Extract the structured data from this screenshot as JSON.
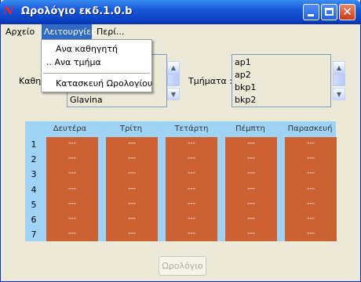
{
  "window": {
    "title": "Ωρολόγιο εκδ.1.0.b",
    "icon_glyph": "Ν",
    "close_glyph": "✕"
  },
  "menubar": {
    "items": [
      "Αρχείο",
      "Λειτουργίες",
      "Περί..."
    ],
    "active": "Λειτουργίες"
  },
  "dropdown": {
    "items": [
      "Ανα καθηγητή",
      ".. Ανα τμήμα",
      "Κατασκευή Ωρολογίου"
    ]
  },
  "teachers": {
    "label": "Καθη",
    "visible_items": [
      "Glavina"
    ]
  },
  "classes": {
    "label": "Τμήματα :",
    "items": [
      "ap1",
      "ap2",
      "bkp1",
      "bkp2"
    ]
  },
  "timetable": {
    "days": [
      "Δευτέρα",
      "Τρίτη",
      "Τετάρτη",
      "Πέμπτη",
      "Παρασκευή"
    ],
    "periods": [
      "1",
      "2",
      "3",
      "4",
      "5",
      "6",
      "7"
    ],
    "cell_text": "---"
  },
  "build_button": {
    "label": "Ωρολόγιο",
    "enabled": false
  },
  "colors": {
    "grid_background": "#9fd3f5",
    "cell_fill": "#cc6134",
    "title_bar": "#0a3fc2",
    "menu_highlight": "#316ac5"
  }
}
